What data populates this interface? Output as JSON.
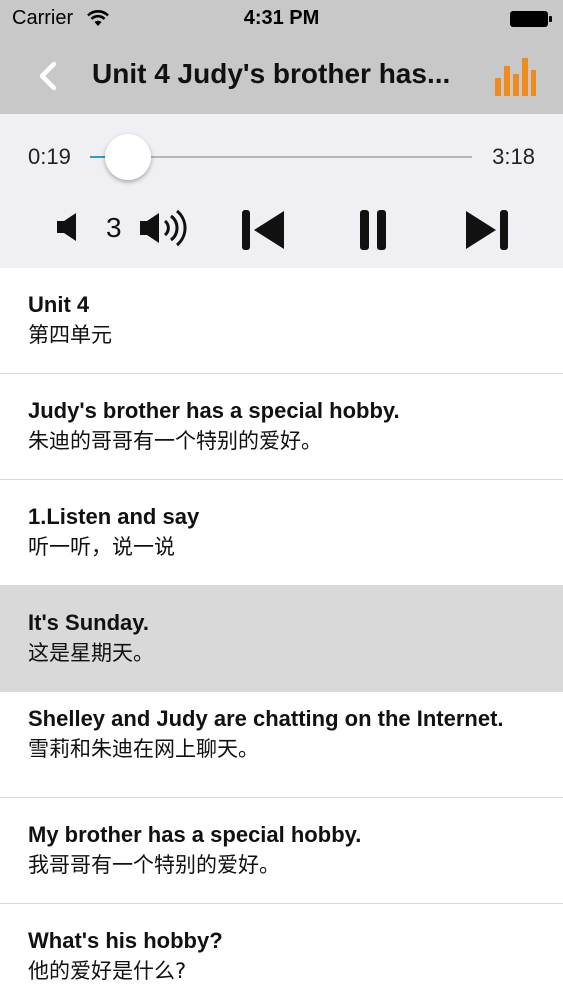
{
  "status_bar": {
    "carrier": "Carrier",
    "time": "4:31 PM"
  },
  "nav": {
    "title": "Unit 4 Judy's brother has...",
    "back_icon": "chevron-left-icon",
    "right_icon": "equalizer-icon",
    "accent_color": "#f08c1e"
  },
  "player": {
    "current_time": "0:19",
    "total_time": "3:18",
    "progress": 0.1,
    "volume_level": "3",
    "accent_color": "#2e9bd6"
  },
  "lines": [
    {
      "en": "Unit 4",
      "cn": "第四单元"
    },
    {
      "en": "Judy's brother has a special hobby.",
      "cn": "朱迪的哥哥有一个特别的爱好。"
    },
    {
      "en": "1.Listen and say",
      "cn": "听一听，说一说"
    },
    {
      "en": "It's Sunday.",
      "cn": "这是星期天。",
      "active": true
    },
    {
      "en": "Shelley and Judy are chatting on the Internet.",
      "cn": "雪莉和朱迪在网上聊天。"
    },
    {
      "en": "My brother has a special hobby.",
      "cn": "我哥哥有一个特别的爱好。"
    },
    {
      "en": "What's his hobby?",
      "cn": "他的爱好是什么?"
    }
  ]
}
